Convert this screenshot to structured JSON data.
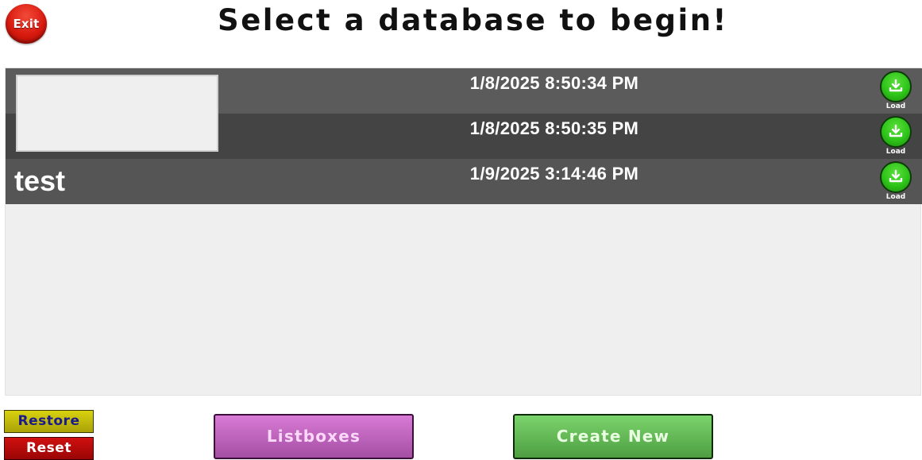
{
  "header": {
    "exit_label": "Exit",
    "title": "Select a database to begin!"
  },
  "databases": [
    {
      "name": "",
      "timestamp": "1/8/2025 8:50:34 PM",
      "load_label": "Load"
    },
    {
      "name": "",
      "timestamp": "1/8/2025 8:50:35 PM",
      "load_label": "Load"
    },
    {
      "name": "test",
      "timestamp": "1/9/2025 3:14:46 PM",
      "load_label": "Load"
    }
  ],
  "footer": {
    "restore_label": "Restore",
    "reset_label": "Reset",
    "listboxes_label": "Listboxes",
    "create_new_label": "Create New"
  },
  "icons": {
    "exit": "exit-button-icon",
    "load": "download-icon"
  },
  "colors": {
    "exit": "#d81a0f",
    "load": "#2ec41a",
    "restore": "#d8d20f",
    "reset": "#c80c0c",
    "listboxes": "#c36ac0",
    "create_new": "#66bb57",
    "row_light": "#5b5b5b",
    "row_dark": "#444444"
  }
}
